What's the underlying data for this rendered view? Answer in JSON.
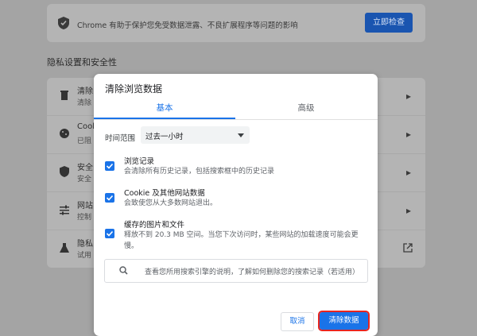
{
  "background": {
    "safety_text": "Chrome 有助于保护您免受数据泄露、不良扩展程序等问题的影响",
    "safety_button": "立即检查",
    "section_title": "隐私设置和安全性",
    "rows": [
      {
        "label": "清除",
        "sub": "清除",
        "icon": "trash-icon"
      },
      {
        "label": "Cook",
        "sub": "已阻",
        "icon": "cookie-icon"
      },
      {
        "label": "安全",
        "sub": "安全",
        "icon": "shield-icon"
      },
      {
        "label": "网站",
        "sub": "控制",
        "icon": "sliders-icon"
      },
      {
        "label": "隐私",
        "sub": "试用",
        "icon": "flask-icon"
      }
    ]
  },
  "dialog": {
    "title": "清除浏览数据",
    "tabs": [
      "基本",
      "高级"
    ],
    "time_range_label": "时间范围",
    "time_range_value": "过去一小时",
    "options": [
      {
        "title": "浏览记录",
        "desc": "会清除所有历史记录，包括搜索框中的历史记录",
        "checked": true
      },
      {
        "title": "Cookie 及其他网站数据",
        "desc": "会致使您从大多数网站退出。",
        "checked": true
      },
      {
        "title": "缓存的图片和文件",
        "desc": "释放不到 20.3 MB 空间。当您下次访问时，某些网站的加载速度可能会更慢。",
        "checked": true
      }
    ],
    "search_info": "查看您所用搜索引擎的说明，了解如何删除您的搜索记录（若适用）",
    "cancel_label": "取消",
    "clear_label": "清除数据"
  },
  "colors": {
    "accent": "#1a73e8",
    "highlight": "#e8251f"
  }
}
